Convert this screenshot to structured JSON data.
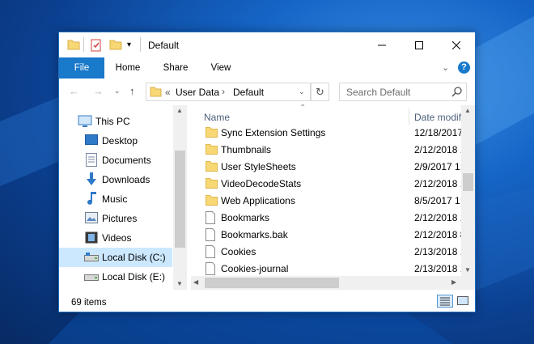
{
  "window": {
    "title": "Default"
  },
  "ribbon": {
    "tabs": [
      {
        "label": "File",
        "active": true
      },
      {
        "label": "Home"
      },
      {
        "label": "Share"
      },
      {
        "label": "View"
      }
    ]
  },
  "address": {
    "overflow": "«",
    "crumbs": [
      "User Data",
      "Default"
    ]
  },
  "search": {
    "placeholder": "Search Default"
  },
  "nav_pane": {
    "items": [
      {
        "label": "This PC",
        "icon": "monitor-icon",
        "level": 0
      },
      {
        "label": "Desktop",
        "icon": "desktop-icon",
        "level": 1
      },
      {
        "label": "Documents",
        "icon": "documents-icon",
        "level": 1
      },
      {
        "label": "Downloads",
        "icon": "download-arrow-icon",
        "level": 1
      },
      {
        "label": "Music",
        "icon": "music-note-icon",
        "level": 1
      },
      {
        "label": "Pictures",
        "icon": "pictures-icon",
        "level": 1
      },
      {
        "label": "Videos",
        "icon": "film-icon",
        "level": 1
      },
      {
        "label": "Local Disk (C:)",
        "icon": "drive-icon",
        "level": 1,
        "selected": true
      },
      {
        "label": "Local Disk (E:)",
        "icon": "drive-icon",
        "level": 1
      }
    ]
  },
  "file_list": {
    "columns": {
      "name": "Name",
      "date": "Date modified"
    },
    "rows": [
      {
        "name": "Sync Extension Settings",
        "date": "12/18/2017",
        "type": "folder"
      },
      {
        "name": "Thumbnails",
        "date": "2/12/2018 1",
        "type": "folder"
      },
      {
        "name": "User StyleSheets",
        "date": "2/9/2017 1:",
        "type": "folder"
      },
      {
        "name": "VideoDecodeStats",
        "date": "2/12/2018 1",
        "type": "folder"
      },
      {
        "name": "Web Applications",
        "date": "8/5/2017 1:",
        "type": "folder"
      },
      {
        "name": "Bookmarks",
        "date": "2/12/2018 1",
        "type": "file"
      },
      {
        "name": "Bookmarks.bak",
        "date": "2/12/2018 8",
        "type": "file"
      },
      {
        "name": "Cookies",
        "date": "2/13/2018 1",
        "type": "file"
      },
      {
        "name": "Cookies-journal",
        "date": "2/13/2018 1",
        "type": "file"
      }
    ]
  },
  "status": {
    "item_count": "69 items"
  },
  "colors": {
    "accent": "#1979ca",
    "selection": "#cce8ff",
    "folder": "#f8d775",
    "header_text": "#4c607a"
  }
}
